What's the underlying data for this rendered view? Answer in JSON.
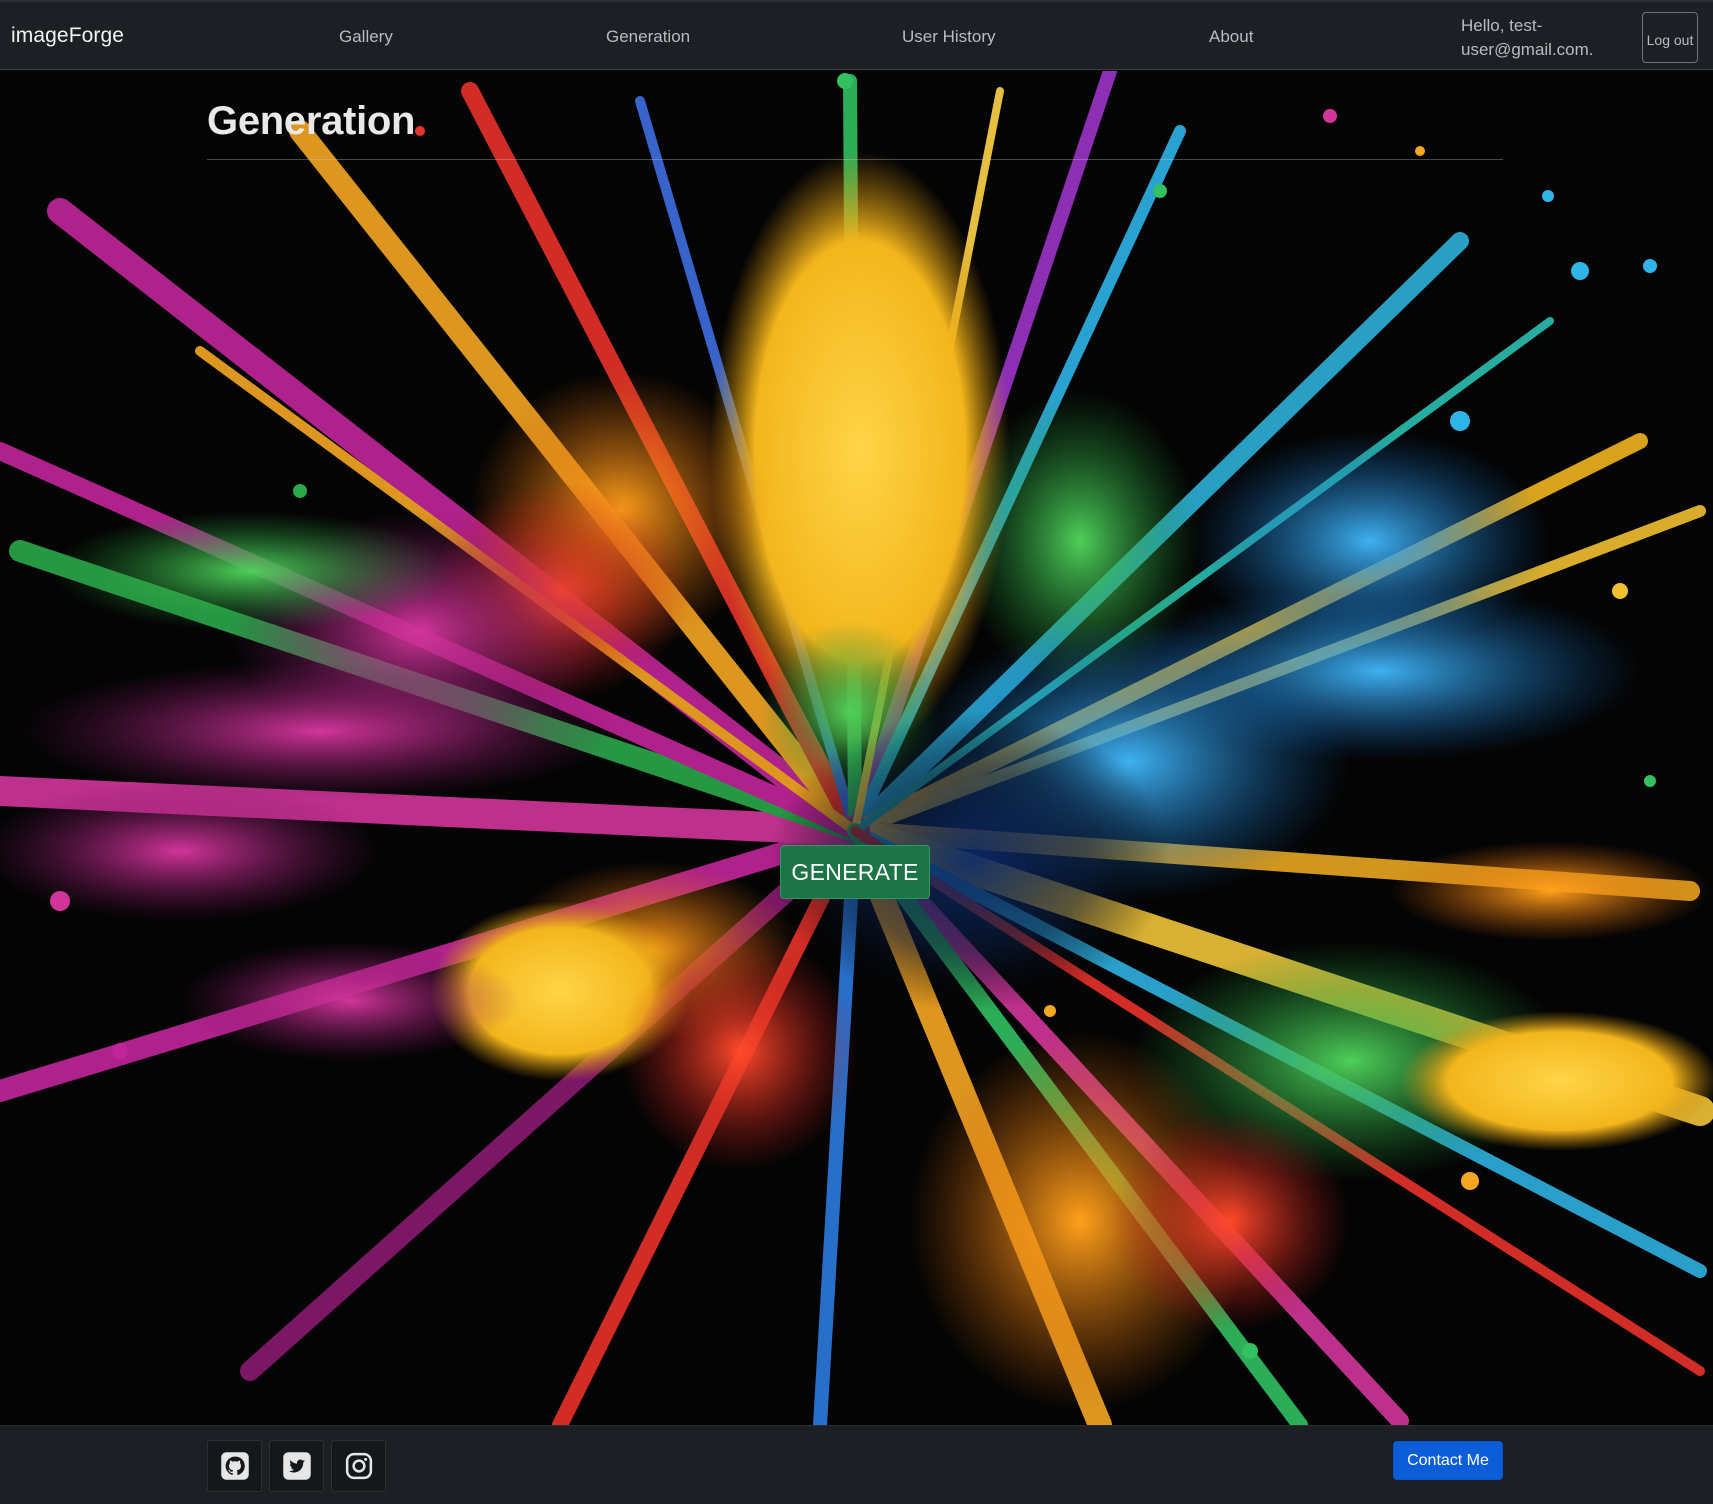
{
  "navbar": {
    "brand": "imageForge",
    "links": [
      {
        "label": "Gallery"
      },
      {
        "label": "Generation"
      },
      {
        "label": "User History"
      },
      {
        "label": "About"
      }
    ],
    "greeting": "Hello, test-user@gmail.com.",
    "logout_label": "Log out"
  },
  "main": {
    "title": "Generation",
    "generate_label": "GENERATE",
    "background_image": "colorful paint powder explosion"
  },
  "footer": {
    "social": [
      {
        "icon": "github-icon"
      },
      {
        "icon": "twitter-icon"
      },
      {
        "icon": "instagram-icon"
      }
    ],
    "contact_label": "Contact Me"
  },
  "colors": {
    "navbar_bg": "#1c1f23",
    "generate_btn": "#1c7447",
    "contact_btn": "#0b5ed7"
  }
}
